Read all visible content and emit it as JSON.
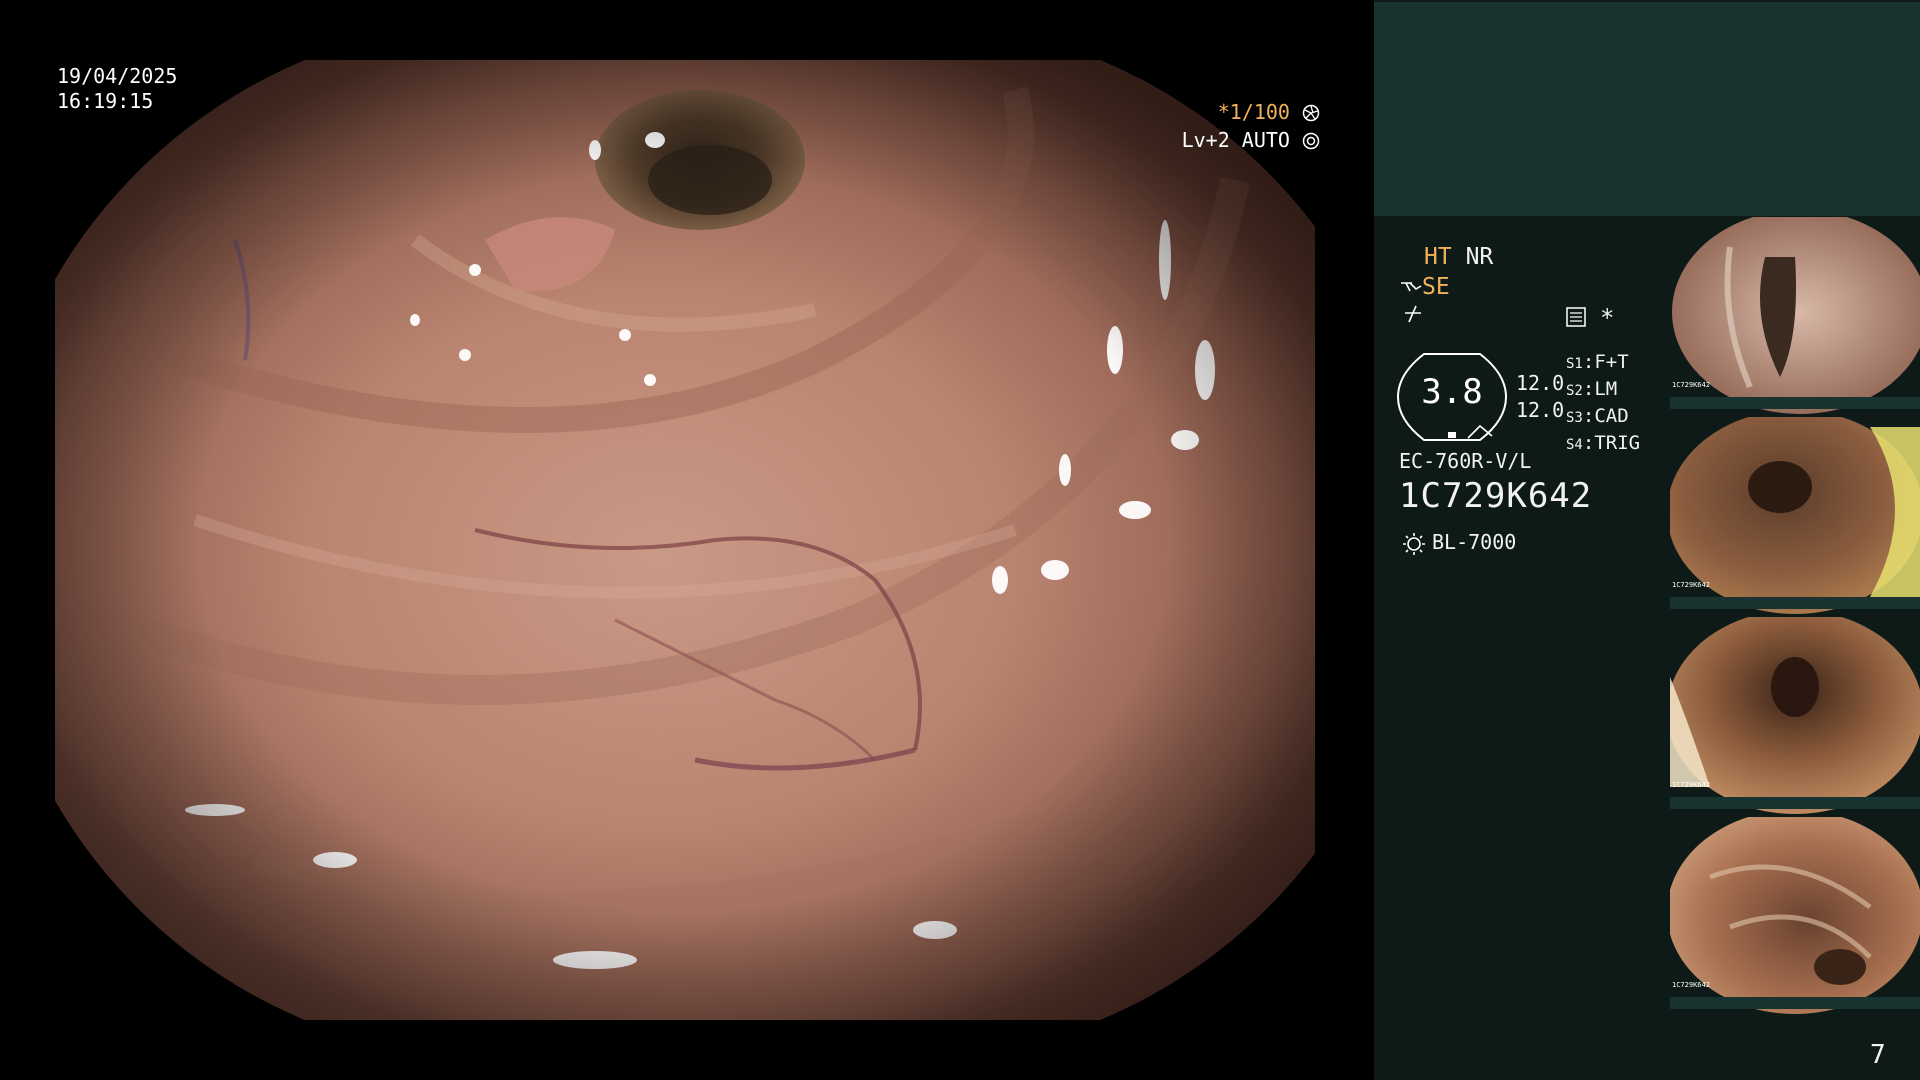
{
  "overlay": {
    "date": "19/04/2025",
    "time": "16:19:15",
    "shutter": "*1/100",
    "shutter_icon": "aperture-icon",
    "level_mode": "Lv+2 AUTO",
    "level_icon": "iris-icon"
  },
  "panel": {
    "mode_ht": "HT",
    "mode_nr": "NR",
    "mode_se": "SE",
    "se_icon": "scope-tip-icon",
    "flash_icon": "freeze-icon",
    "settings_icon": "menu-sheet-icon",
    "star": "*",
    "gauge_value": "3.8",
    "gauge_values": [
      "12.0",
      "12.0"
    ],
    "switches": [
      {
        "key": "S1",
        "value": "F+T"
      },
      {
        "key": "S2",
        "value": "LM"
      },
      {
        "key": "S3",
        "value": "CAD"
      },
      {
        "key": "S4",
        "value": "TRIG"
      }
    ],
    "scope_model": "EC-760R-V/L",
    "scope_serial": "1C729K642",
    "light_source": "BL-7000",
    "light_icon": "light-bulb-icon",
    "page_number": "7"
  },
  "thumbnails": [
    {
      "serial": "1C729K642"
    },
    {
      "serial": "1C729K642"
    },
    {
      "serial": "1C729K642"
    },
    {
      "serial": "1C729K642"
    }
  ],
  "colors": {
    "panel_bg": "#0e1a18",
    "panel_top": "#193330",
    "accent_orange": "#f3b25a",
    "mucosa": "#b98470"
  }
}
